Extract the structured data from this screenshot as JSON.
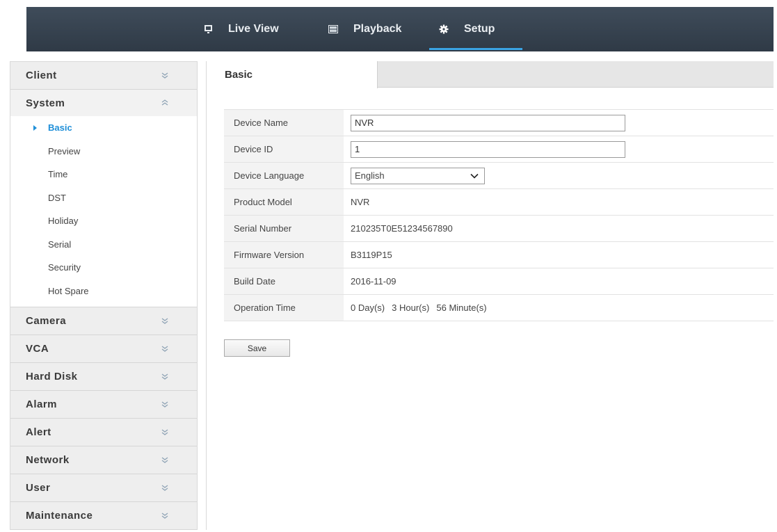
{
  "topnav": {
    "items": [
      {
        "label": "Live View",
        "icon": "monitor-icon"
      },
      {
        "label": "Playback",
        "icon": "film-icon"
      },
      {
        "label": "Setup",
        "icon": "gear-icon",
        "active": true
      }
    ],
    "accent": "#3aa3e3"
  },
  "sidebar": {
    "client": "Client",
    "system": "System",
    "system_items": [
      "Basic",
      "Preview",
      "Time",
      "DST",
      "Holiday",
      "Serial",
      "Security",
      "Hot Spare"
    ],
    "active_item": "Basic",
    "sections": [
      "Camera",
      "VCA",
      "Hard Disk",
      "Alarm",
      "Alert",
      "Network",
      "User",
      "Maintenance"
    ]
  },
  "main": {
    "tab": "Basic",
    "fields": {
      "device_name": {
        "label": "Device Name",
        "value": "NVR"
      },
      "device_id": {
        "label": "Device ID",
        "value": "1"
      },
      "device_language": {
        "label": "Device Language",
        "value": "English"
      },
      "product_model": {
        "label": "Product Model",
        "value": "NVR"
      },
      "serial_number": {
        "label": "Serial Number",
        "value": "210235T0E51234567890"
      },
      "firmware_version": {
        "label": "Firmware Version",
        "value": "B3119P15"
      },
      "build_date": {
        "label": "Build Date",
        "value": "2016-11-09"
      },
      "operation_time": {
        "label": "Operation Time",
        "days": "0",
        "days_unit": "Day(s)",
        "hours": "3",
        "hours_unit": "Hour(s)",
        "minutes": "56",
        "minutes_unit": "Minute(s)"
      }
    },
    "save_label": "Save"
  }
}
